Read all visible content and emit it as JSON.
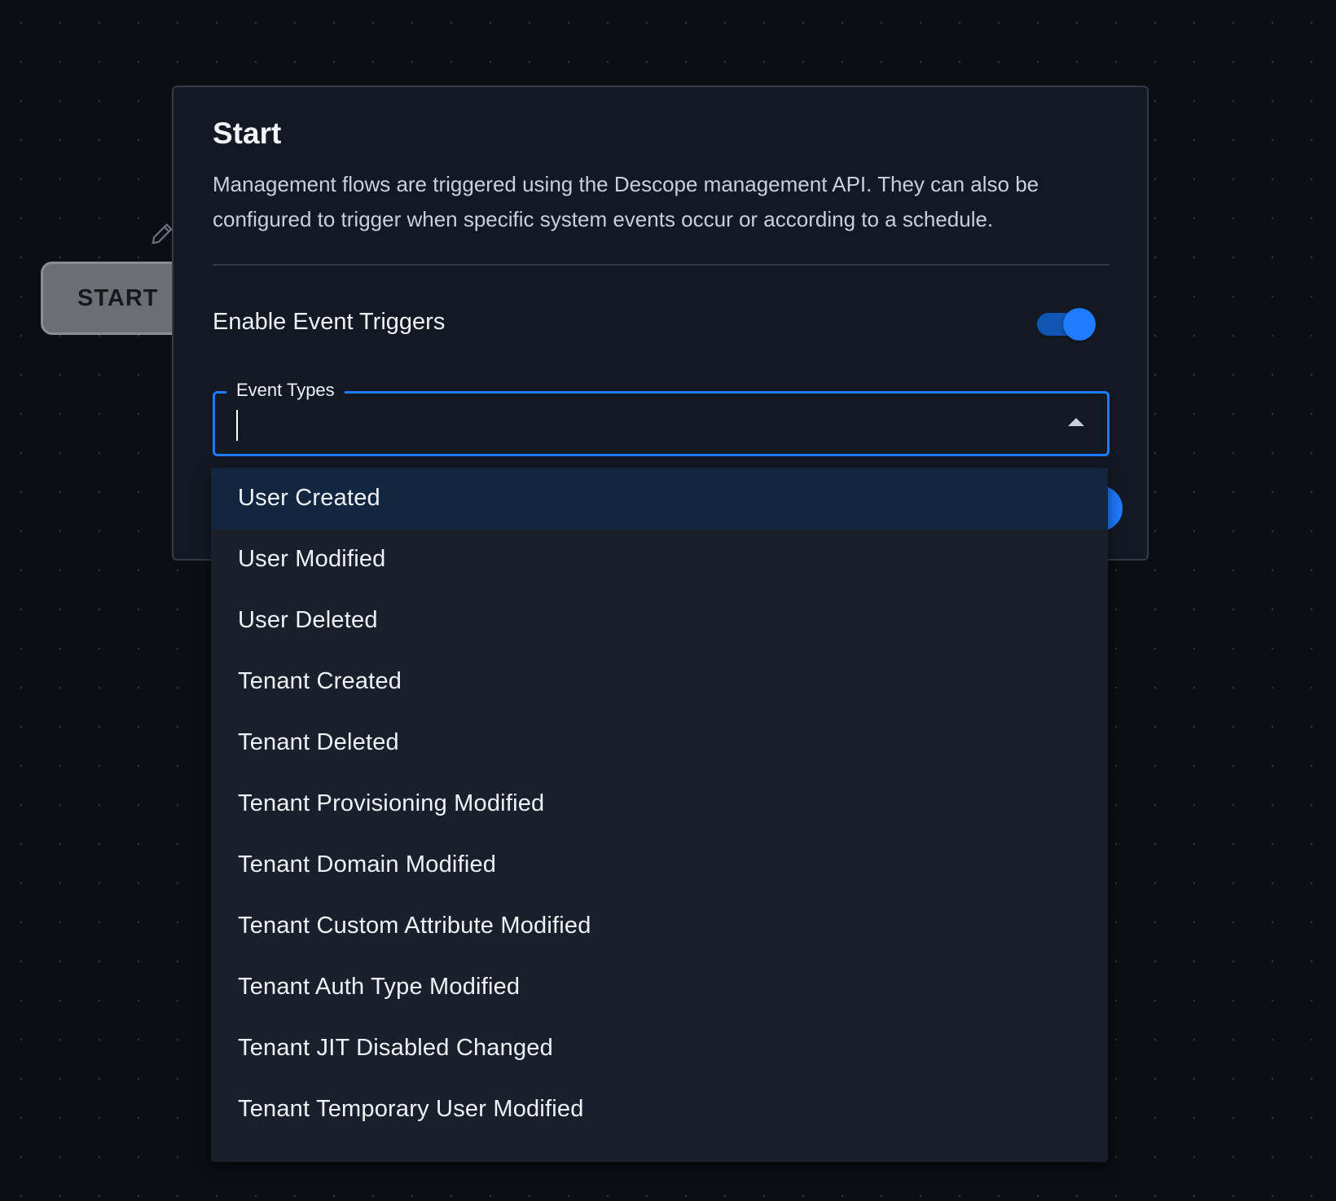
{
  "canvas": {
    "start_node_label": "START"
  },
  "panel": {
    "title": "Start",
    "description": "Management flows are triggered using the Descope management API. They can also be configured to trigger when specific system events occur or according to a schedule.",
    "event_triggers": {
      "label": "Enable Event Triggers",
      "enabled": true
    },
    "event_types_field": {
      "label": "Event Types",
      "value": "",
      "open": true
    }
  },
  "dropdown": {
    "highlighted_index": 0,
    "options": [
      {
        "label": "User Created"
      },
      {
        "label": "User Modified"
      },
      {
        "label": "User Deleted"
      },
      {
        "label": "Tenant Created"
      },
      {
        "label": "Tenant Deleted"
      },
      {
        "label": "Tenant Provisioning Modified"
      },
      {
        "label": "Tenant Domain Modified"
      },
      {
        "label": "Tenant Custom Attribute Modified"
      },
      {
        "label": "Tenant Auth Type Modified"
      },
      {
        "label": "Tenant JIT Disabled Changed"
      },
      {
        "label": "Tenant Temporary User Modified"
      }
    ]
  },
  "colors": {
    "accent": "#1f7bff",
    "background": "#0b0e14",
    "panel": "#131923",
    "dropdown": "#1a202b",
    "highlight": "#132640"
  },
  "icons": {
    "edit": "pencil-icon",
    "dropdown_toggle": "arrow-up-icon"
  }
}
